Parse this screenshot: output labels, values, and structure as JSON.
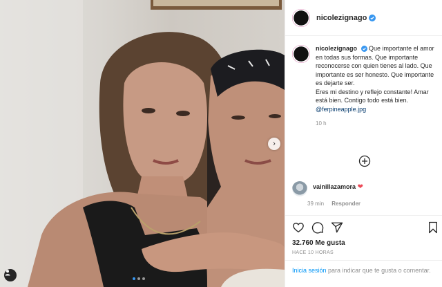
{
  "post": {
    "username": "nicolezignago",
    "verified": true,
    "caption": {
      "username": "nicolezignago",
      "text": "Que importante el amor en todas sus formas. Que importante reconocerse con quien tienes al lado. Que importante es ser honesto. Que importante es dejarte ser.",
      "text2": "Eres mi destino y reflejo constante! Amar está bien. Contigo todo está bien.",
      "mention": "@ferpineapple.jpg",
      "time": "10 h"
    },
    "comment": {
      "username": "vainillazamora",
      "heart": "❤",
      "time": "39 min",
      "reply_label": "Responder"
    },
    "likes": "32.760 Me gusta",
    "posted_ago": "HACE 10 HORAS",
    "login": {
      "link": "Inicia sesión",
      "text": "para indicar que te gusta o comentar."
    },
    "carousel": {
      "slides": 3,
      "active": 0
    }
  },
  "colors": {
    "link": "#00376b",
    "login_link": "#0095f6",
    "heart": "#ed4956",
    "carousel_active_dot": "#3897f0"
  },
  "icons": {
    "verified": "verified-badge-icon",
    "next": "chevron-right-icon",
    "tag": "user-tag-icon",
    "more": "plus-circle-icon",
    "like": "heart-outline-icon",
    "comment": "comment-bubble-icon",
    "share": "paper-plane-icon",
    "save": "bookmark-icon"
  }
}
